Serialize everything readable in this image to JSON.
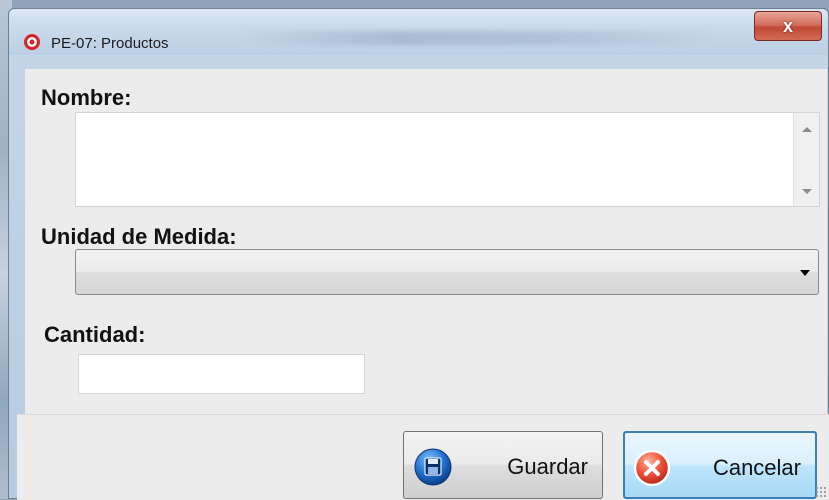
{
  "window": {
    "title": "PE-07: Productos",
    "close_label": "x"
  },
  "form": {
    "nombre_label": "Nombre:",
    "nombre_value": "",
    "unidad_label": "Unidad de Medida:",
    "unidad_value": "",
    "cantidad_label": "Cantidad:",
    "cantidad_value": ""
  },
  "buttons": {
    "save_label": "Guardar",
    "cancel_label": "Cancelar"
  },
  "icons": {
    "app": "target-icon",
    "save": "floppy-disk-icon",
    "cancel": "cancel-x-icon"
  },
  "colors": {
    "title_bar": "#c8d9ea",
    "close_button": "#c14a35",
    "cancel_focus_border": "#3c7fb1",
    "client_background": "#ececec"
  }
}
